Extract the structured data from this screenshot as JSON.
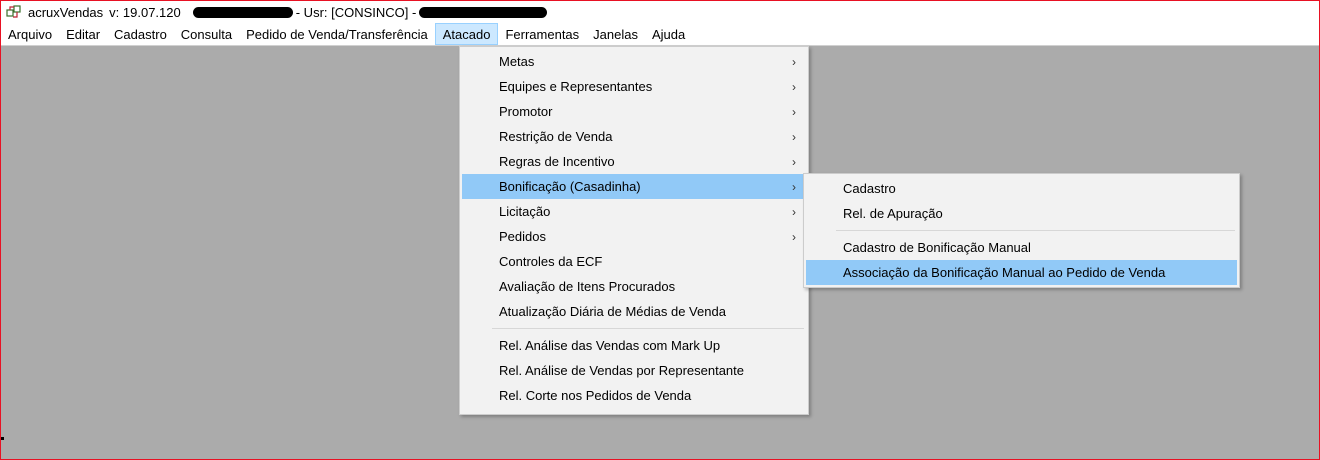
{
  "title": {
    "app_name": "acruxVendas",
    "version": "v: 19.07.120",
    "user": "- Usr: [CONSINCO] -"
  },
  "menubar": {
    "items": [
      {
        "label": "Arquivo"
      },
      {
        "label": "Editar"
      },
      {
        "label": "Cadastro"
      },
      {
        "label": "Consulta"
      },
      {
        "label": "Pedido de Venda/Transferência"
      },
      {
        "label": "Atacado"
      },
      {
        "label": "Ferramentas"
      },
      {
        "label": "Janelas"
      },
      {
        "label": "Ajuda"
      }
    ],
    "active": "Atacado"
  },
  "atacado_menu": {
    "items": [
      {
        "label": "Metas",
        "submenu": true
      },
      {
        "label": "Equipes e Representantes",
        "submenu": true
      },
      {
        "label": "Promotor",
        "submenu": true
      },
      {
        "label": "Restrição de Venda",
        "submenu": true
      },
      {
        "label": "Regras de Incentivo",
        "submenu": true
      },
      {
        "label": "Bonificação (Casadinha)",
        "submenu": true,
        "highlighted": true
      },
      {
        "label": "Licitação",
        "submenu": true
      },
      {
        "label": "Pedidos",
        "submenu": true
      },
      {
        "label": "Controles da ECF"
      },
      {
        "label": "Avaliação de Itens Procurados"
      },
      {
        "label": "Atualização Diária de Médias de Venda"
      },
      {
        "label": "Rel. Análise das Vendas com Mark Up"
      },
      {
        "label": "Rel. Análise de Vendas por Representante"
      },
      {
        "label": "Rel. Corte nos Pedidos de Venda"
      }
    ],
    "arrow": "›"
  },
  "bonificacao_submenu": {
    "items": [
      {
        "label": "Cadastro"
      },
      {
        "label": "Rel. de Apuração"
      },
      {
        "label": "Cadastro de Bonificação Manual"
      },
      {
        "label": "Associação da Bonificação Manual ao Pedido de Venda",
        "highlighted": true
      }
    ]
  },
  "colors": {
    "workspace": "#ababab",
    "menu_bg": "#f2f2f2",
    "highlight": "#91c9f7",
    "active_menubar": "#cce8ff",
    "window_border": "#e81123"
  }
}
